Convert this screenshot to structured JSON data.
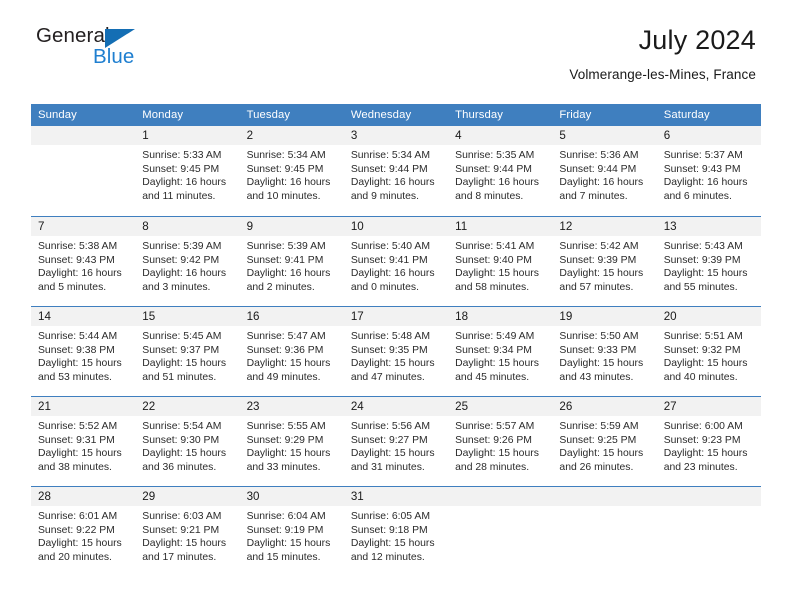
{
  "brand": {
    "name_part1": "General",
    "name_part2": "Blue",
    "accent_color": "#1f7fd0",
    "triangle_color": "#146eb4"
  },
  "header": {
    "title": "July 2024",
    "subtitle": "Volmerange-les-Mines, France"
  },
  "calendar": {
    "header_bg": "#3f7fbf",
    "daynum_bg": "#f2f2f2",
    "weekdays": [
      "Sunday",
      "Monday",
      "Tuesday",
      "Wednesday",
      "Thursday",
      "Friday",
      "Saturday"
    ],
    "weeks": [
      [
        {
          "day": ""
        },
        {
          "day": "1",
          "sunrise": "Sunrise: 5:33 AM",
          "sunset": "Sunset: 9:45 PM",
          "daylight1": "Daylight: 16 hours",
          "daylight2": "and 11 minutes."
        },
        {
          "day": "2",
          "sunrise": "Sunrise: 5:34 AM",
          "sunset": "Sunset: 9:45 PM",
          "daylight1": "Daylight: 16 hours",
          "daylight2": "and 10 minutes."
        },
        {
          "day": "3",
          "sunrise": "Sunrise: 5:34 AM",
          "sunset": "Sunset: 9:44 PM",
          "daylight1": "Daylight: 16 hours",
          "daylight2": "and 9 minutes."
        },
        {
          "day": "4",
          "sunrise": "Sunrise: 5:35 AM",
          "sunset": "Sunset: 9:44 PM",
          "daylight1": "Daylight: 16 hours",
          "daylight2": "and 8 minutes."
        },
        {
          "day": "5",
          "sunrise": "Sunrise: 5:36 AM",
          "sunset": "Sunset: 9:44 PM",
          "daylight1": "Daylight: 16 hours",
          "daylight2": "and 7 minutes."
        },
        {
          "day": "6",
          "sunrise": "Sunrise: 5:37 AM",
          "sunset": "Sunset: 9:43 PM",
          "daylight1": "Daylight: 16 hours",
          "daylight2": "and 6 minutes."
        }
      ],
      [
        {
          "day": "7",
          "sunrise": "Sunrise: 5:38 AM",
          "sunset": "Sunset: 9:43 PM",
          "daylight1": "Daylight: 16 hours",
          "daylight2": "and 5 minutes."
        },
        {
          "day": "8",
          "sunrise": "Sunrise: 5:39 AM",
          "sunset": "Sunset: 9:42 PM",
          "daylight1": "Daylight: 16 hours",
          "daylight2": "and 3 minutes."
        },
        {
          "day": "9",
          "sunrise": "Sunrise: 5:39 AM",
          "sunset": "Sunset: 9:41 PM",
          "daylight1": "Daylight: 16 hours",
          "daylight2": "and 2 minutes."
        },
        {
          "day": "10",
          "sunrise": "Sunrise: 5:40 AM",
          "sunset": "Sunset: 9:41 PM",
          "daylight1": "Daylight: 16 hours",
          "daylight2": "and 0 minutes."
        },
        {
          "day": "11",
          "sunrise": "Sunrise: 5:41 AM",
          "sunset": "Sunset: 9:40 PM",
          "daylight1": "Daylight: 15 hours",
          "daylight2": "and 58 minutes."
        },
        {
          "day": "12",
          "sunrise": "Sunrise: 5:42 AM",
          "sunset": "Sunset: 9:39 PM",
          "daylight1": "Daylight: 15 hours",
          "daylight2": "and 57 minutes."
        },
        {
          "day": "13",
          "sunrise": "Sunrise: 5:43 AM",
          "sunset": "Sunset: 9:39 PM",
          "daylight1": "Daylight: 15 hours",
          "daylight2": "and 55 minutes."
        }
      ],
      [
        {
          "day": "14",
          "sunrise": "Sunrise: 5:44 AM",
          "sunset": "Sunset: 9:38 PM",
          "daylight1": "Daylight: 15 hours",
          "daylight2": "and 53 minutes."
        },
        {
          "day": "15",
          "sunrise": "Sunrise: 5:45 AM",
          "sunset": "Sunset: 9:37 PM",
          "daylight1": "Daylight: 15 hours",
          "daylight2": "and 51 minutes."
        },
        {
          "day": "16",
          "sunrise": "Sunrise: 5:47 AM",
          "sunset": "Sunset: 9:36 PM",
          "daylight1": "Daylight: 15 hours",
          "daylight2": "and 49 minutes."
        },
        {
          "day": "17",
          "sunrise": "Sunrise: 5:48 AM",
          "sunset": "Sunset: 9:35 PM",
          "daylight1": "Daylight: 15 hours",
          "daylight2": "and 47 minutes."
        },
        {
          "day": "18",
          "sunrise": "Sunrise: 5:49 AM",
          "sunset": "Sunset: 9:34 PM",
          "daylight1": "Daylight: 15 hours",
          "daylight2": "and 45 minutes."
        },
        {
          "day": "19",
          "sunrise": "Sunrise: 5:50 AM",
          "sunset": "Sunset: 9:33 PM",
          "daylight1": "Daylight: 15 hours",
          "daylight2": "and 43 minutes."
        },
        {
          "day": "20",
          "sunrise": "Sunrise: 5:51 AM",
          "sunset": "Sunset: 9:32 PM",
          "daylight1": "Daylight: 15 hours",
          "daylight2": "and 40 minutes."
        }
      ],
      [
        {
          "day": "21",
          "sunrise": "Sunrise: 5:52 AM",
          "sunset": "Sunset: 9:31 PM",
          "daylight1": "Daylight: 15 hours",
          "daylight2": "and 38 minutes."
        },
        {
          "day": "22",
          "sunrise": "Sunrise: 5:54 AM",
          "sunset": "Sunset: 9:30 PM",
          "daylight1": "Daylight: 15 hours",
          "daylight2": "and 36 minutes."
        },
        {
          "day": "23",
          "sunrise": "Sunrise: 5:55 AM",
          "sunset": "Sunset: 9:29 PM",
          "daylight1": "Daylight: 15 hours",
          "daylight2": "and 33 minutes."
        },
        {
          "day": "24",
          "sunrise": "Sunrise: 5:56 AM",
          "sunset": "Sunset: 9:27 PM",
          "daylight1": "Daylight: 15 hours",
          "daylight2": "and 31 minutes."
        },
        {
          "day": "25",
          "sunrise": "Sunrise: 5:57 AM",
          "sunset": "Sunset: 9:26 PM",
          "daylight1": "Daylight: 15 hours",
          "daylight2": "and 28 minutes."
        },
        {
          "day": "26",
          "sunrise": "Sunrise: 5:59 AM",
          "sunset": "Sunset: 9:25 PM",
          "daylight1": "Daylight: 15 hours",
          "daylight2": "and 26 minutes."
        },
        {
          "day": "27",
          "sunrise": "Sunrise: 6:00 AM",
          "sunset": "Sunset: 9:23 PM",
          "daylight1": "Daylight: 15 hours",
          "daylight2": "and 23 minutes."
        }
      ],
      [
        {
          "day": "28",
          "sunrise": "Sunrise: 6:01 AM",
          "sunset": "Sunset: 9:22 PM",
          "daylight1": "Daylight: 15 hours",
          "daylight2": "and 20 minutes."
        },
        {
          "day": "29",
          "sunrise": "Sunrise: 6:03 AM",
          "sunset": "Sunset: 9:21 PM",
          "daylight1": "Daylight: 15 hours",
          "daylight2": "and 17 minutes."
        },
        {
          "day": "30",
          "sunrise": "Sunrise: 6:04 AM",
          "sunset": "Sunset: 9:19 PM",
          "daylight1": "Daylight: 15 hours",
          "daylight2": "and 15 minutes."
        },
        {
          "day": "31",
          "sunrise": "Sunrise: 6:05 AM",
          "sunset": "Sunset: 9:18 PM",
          "daylight1": "Daylight: 15 hours",
          "daylight2": "and 12 minutes."
        },
        {
          "day": ""
        },
        {
          "day": ""
        },
        {
          "day": ""
        }
      ]
    ]
  }
}
